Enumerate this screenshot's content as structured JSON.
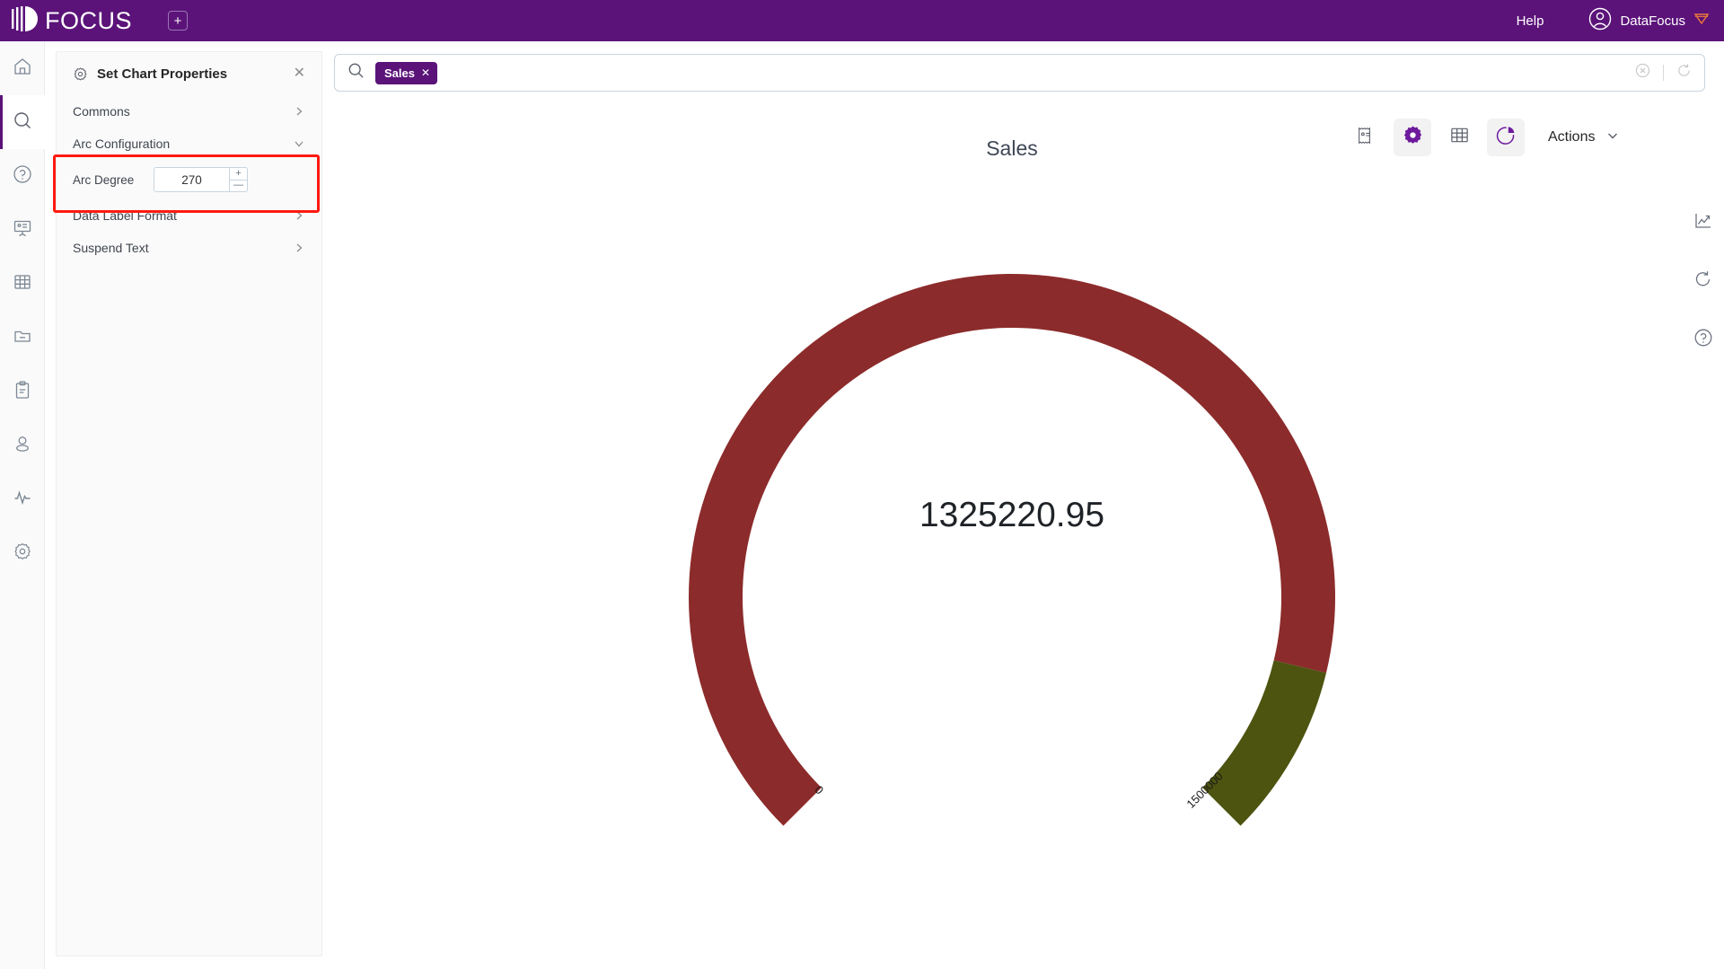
{
  "topbar": {
    "brand": "FOCUS",
    "new_tab_icon": "plus-square-icon",
    "help_label": "Help",
    "user_name": "DataFocus",
    "avatar_icon": "user-circle-icon",
    "badge_icon": "diamond-badge-icon",
    "background": "#5b1379"
  },
  "rail": {
    "items": [
      {
        "icon": "home-icon",
        "name": "home",
        "active": false
      },
      {
        "icon": "search-icon",
        "name": "search",
        "active": true
      },
      {
        "icon": "help-circle-icon",
        "name": "help",
        "active": false
      },
      {
        "icon": "presentation-icon",
        "name": "dashboard",
        "active": false
      },
      {
        "icon": "table-grid-icon",
        "name": "data-table",
        "active": false
      },
      {
        "icon": "folder-minus-icon",
        "name": "resources",
        "active": false
      },
      {
        "icon": "clipboard-icon",
        "name": "tasks",
        "active": false
      },
      {
        "icon": "user-icon",
        "name": "users",
        "active": false
      },
      {
        "icon": "pulse-icon",
        "name": "monitoring",
        "active": false
      },
      {
        "icon": "gear-icon",
        "name": "settings",
        "active": false
      }
    ]
  },
  "panel": {
    "icon": "gear-icon",
    "title": "Set Chart Properties",
    "close_icon": "close-icon",
    "sections": [
      {
        "label": "Commons",
        "state": "collapsed",
        "chevron": "chevron-right-icon"
      },
      {
        "label": "Arc Configuration",
        "state": "expanded",
        "chevron": "chevron-down-icon"
      },
      {
        "label": "Data Label Format",
        "state": "collapsed",
        "chevron": "chevron-right-icon"
      },
      {
        "label": "Suspend Text",
        "state": "collapsed",
        "chevron": "chevron-right-icon"
      }
    ],
    "arc_degree": {
      "label": "Arc Degree",
      "value": "270",
      "increment_icon": "plus-icon",
      "decrement_icon": "minus-icon"
    },
    "highlight_color": "#ff1a10"
  },
  "search": {
    "icon": "search-icon",
    "chip_label": "Sales",
    "chip_remove_icon": "close-icon",
    "clear_icon": "clear-circle-icon",
    "refresh_icon": "refresh-icon",
    "placeholder": ""
  },
  "chart_toolbar": {
    "buttons": [
      {
        "name": "summary-card",
        "icon": "receipt-icon",
        "selected": false
      },
      {
        "name": "chart-properties",
        "icon": "gear-icon",
        "selected": true
      },
      {
        "name": "table-view",
        "icon": "table-grid-icon",
        "selected": false
      },
      {
        "name": "chart-type",
        "icon": "pie-chart-icon",
        "selected": true
      }
    ],
    "actions_label": "Actions",
    "actions_chevron": "chevron-down-icon"
  },
  "edge_tools": [
    {
      "name": "trend-chart",
      "icon": "line-chart-icon"
    },
    {
      "name": "refresh",
      "icon": "refresh-icon"
    },
    {
      "name": "help",
      "icon": "help-circle-icon"
    }
  ],
  "chart_data": {
    "type": "gauge",
    "title": "Sales",
    "value": 1325220.95,
    "value_label": "1325220.95",
    "min": 0,
    "max": 1500000,
    "tick_labels": [
      "0",
      "1500000"
    ],
    "arc_degree": 270,
    "start_angle_deg": 225,
    "end_angle_deg": -45,
    "series": [
      {
        "name": "value-arc",
        "from": 0,
        "to": 1325220.95,
        "color": "#8c2b2b"
      },
      {
        "name": "remainder-arc",
        "from": 1325220.95,
        "to": 1500000,
        "color": "#4d5410"
      }
    ],
    "ring_outer_radius": 360,
    "ring_inner_radius": 300,
    "title_color": "#3f4756",
    "value_color": "#1f2327"
  }
}
